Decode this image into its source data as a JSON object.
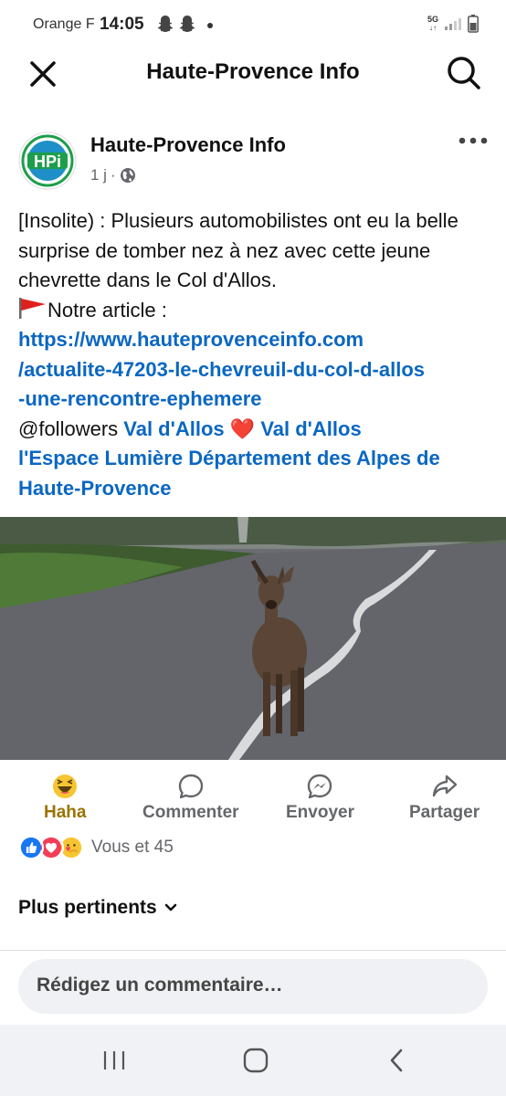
{
  "status_bar": {
    "carrier": "Orange F",
    "time": "14:05",
    "network": "5G"
  },
  "header": {
    "title": "Haute-Provence Info",
    "close_icon": "close-icon",
    "search_icon": "search-icon"
  },
  "post": {
    "page_name": "Haute-Provence Info",
    "avatar_text": "HPi",
    "time_ago": "1 j",
    "separator": "·",
    "text_line1": "[Insolite) : Plusieurs automobilistes ont eu la belle surprise de tomber nez à nez avec cette jeune chevrette dans le Col d'Allos.",
    "article_label": "Notre article :",
    "link_line1": "https://www.hauteprovenceinfo.com",
    "link_line2": "/actualite-47203-le-chevreuil-du-col-d-allos",
    "link_line3": "-une-rencontre-ephemere",
    "mention_followers": "@followers",
    "tag1": "Val d'Allos",
    "heart": "❤️",
    "tag2": "Val d'Allos",
    "tag3": "l'Espace Lumière",
    "tag4": "Département des Alpes de Haute-Provence"
  },
  "actions": {
    "haha": "Haha",
    "comment": "Commenter",
    "send": "Envoyer",
    "share": "Partager"
  },
  "reactions": {
    "count_text": "Vous et 45",
    "icons": [
      "like-icon",
      "love-icon",
      "care-icon"
    ]
  },
  "sort": {
    "label": "Plus pertinents"
  },
  "comment": {
    "placeholder": "Rédigez un commentaire…"
  },
  "colors": {
    "link": "#0a67c2",
    "secondary_text": "#65676b",
    "haha": "#9a7300",
    "input_bg": "#eff1f4"
  }
}
